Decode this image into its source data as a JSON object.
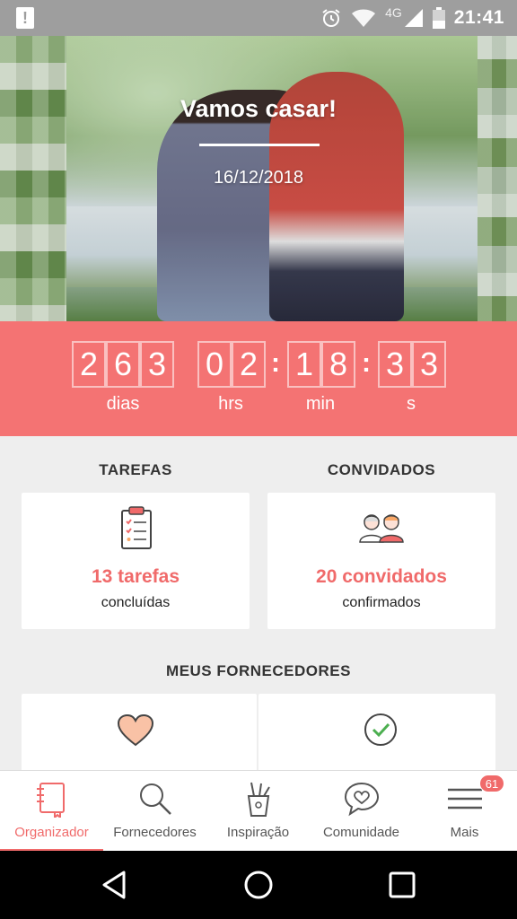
{
  "status_bar": {
    "network": "4G",
    "time": "21:41"
  },
  "hero": {
    "title": "Vamos casar!",
    "date": "16/12/2018"
  },
  "countdown": {
    "days": [
      "2",
      "6",
      "3"
    ],
    "hours": [
      "0",
      "2"
    ],
    "minutes": [
      "1",
      "8"
    ],
    "seconds": [
      "3",
      "3"
    ],
    "labels": {
      "days": "dias",
      "hours": "hrs",
      "minutes": "min",
      "seconds": "s"
    }
  },
  "tasks": {
    "title": "TAREFAS",
    "count": "13 tarefas",
    "status": "concluídas",
    "icon": "clipboard-icon"
  },
  "guests": {
    "title": "CONVIDADOS",
    "count": "20 convidados",
    "status": "confirmados",
    "icon": "couple-icon"
  },
  "vendors": {
    "title": "MEUS FORNECEDORES",
    "icons": [
      "heart-icon",
      "check-circle-icon"
    ]
  },
  "bottom_nav": {
    "items": [
      {
        "label": "Organizador",
        "icon": "notebook-icon",
        "active": true
      },
      {
        "label": "Fornecedores",
        "icon": "search-icon"
      },
      {
        "label": "Inspiração",
        "icon": "pen-cup-icon"
      },
      {
        "label": "Comunidade",
        "icon": "heart-chat-icon"
      },
      {
        "label": "Mais",
        "icon": "menu-icon",
        "badge": "61"
      }
    ]
  },
  "colors": {
    "accent": "#f06a6a",
    "countdown_bg": "#f47373",
    "status_bar": "#9e9e9e"
  }
}
